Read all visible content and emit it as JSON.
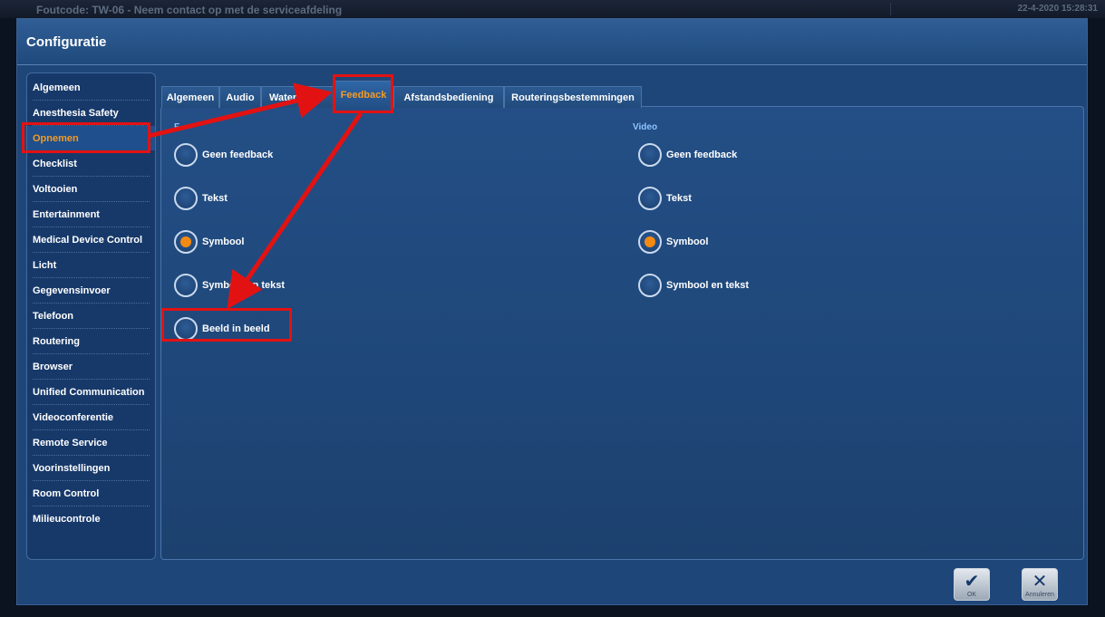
{
  "topbar": {
    "error": "Foutcode: TW-06 - Neem contact op met de serviceafdeling",
    "datetime": "22-4-2020  15:28:31"
  },
  "window": {
    "title": "Configuratie"
  },
  "sidebar": {
    "items": [
      {
        "label": "Algemeen"
      },
      {
        "label": "Anesthesia Safety"
      },
      {
        "label": "Opnemen",
        "active": true
      },
      {
        "label": "Checklist"
      },
      {
        "label": "Voltooien"
      },
      {
        "label": "Entertainment"
      },
      {
        "label": "Medical Device Control"
      },
      {
        "label": "Licht"
      },
      {
        "label": "Gegevensinvoer"
      },
      {
        "label": "Telefoon"
      },
      {
        "label": "Routering"
      },
      {
        "label": "Browser"
      },
      {
        "label": "Unified Communication"
      },
      {
        "label": "Videoconferentie"
      },
      {
        "label": "Remote Service"
      },
      {
        "label": "Voorinstellingen"
      },
      {
        "label": "Room Control"
      },
      {
        "label": "Milieucontrole"
      }
    ]
  },
  "tabs": [
    {
      "label": "Algemeen"
    },
    {
      "label": "Audio"
    },
    {
      "label": "Waterm"
    },
    {
      "label": "Feedback",
      "active": true
    },
    {
      "label": "Afstandsbediening"
    },
    {
      "label": "Routeringsbestemmingen"
    }
  ],
  "groups": {
    "left": {
      "label": "F",
      "options": [
        {
          "label": "Geen feedback",
          "selected": false
        },
        {
          "label": "Tekst",
          "selected": false
        },
        {
          "label": "Symbool",
          "selected": true
        },
        {
          "label": "Symbool en tekst",
          "selected": false
        },
        {
          "label": "Beeld in beeld",
          "selected": false
        }
      ]
    },
    "right": {
      "label": "Video",
      "options": [
        {
          "label": "Geen feedback",
          "selected": false
        },
        {
          "label": "Tekst",
          "selected": false
        },
        {
          "label": "Symbool",
          "selected": true
        },
        {
          "label": "Symbool en tekst",
          "selected": false
        }
      ]
    }
  },
  "buttons": {
    "ok": {
      "label": "OK",
      "icon": "check-icon"
    },
    "cancel": {
      "label": "Annuleren",
      "icon": "close-icon"
    }
  },
  "colors": {
    "accent": "#f59a23",
    "highlight": "#e31212"
  }
}
